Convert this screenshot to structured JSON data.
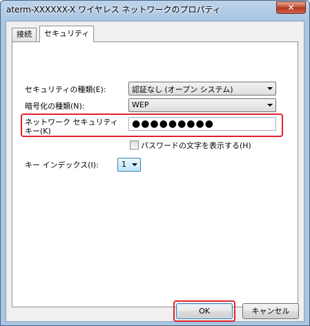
{
  "window": {
    "title": "aterm-XXXXXX-X ワイヤレス ネットワークのプロパティ",
    "close_label": "✕"
  },
  "tabs": [
    {
      "label": "接続"
    },
    {
      "label": "セキュリティ"
    }
  ],
  "security": {
    "type_label": "セキュリティの種類(E):",
    "type_value": "認証なし (オープン システム)",
    "encryption_label": "暗号化の種類(N):",
    "encryption_value": "WEP",
    "key_label_line1": "ネットワーク セキュリティ",
    "key_label_line2": "キー(K)",
    "key_value": "●●●●●●●●●",
    "show_chars_label": "パスワードの文字を表示する(H)",
    "show_chars_checked": false,
    "key_index_label": "キー インデックス(I):",
    "key_index_value": "1"
  },
  "buttons": {
    "ok_label": "OK",
    "cancel_label": "キャンセル"
  },
  "colors": {
    "highlight": "#e0202a",
    "title_bar": "#a9c5e2"
  }
}
